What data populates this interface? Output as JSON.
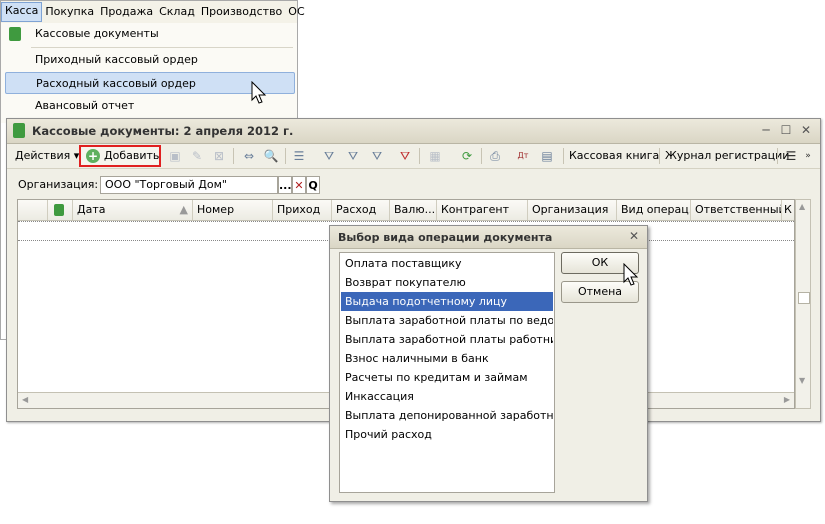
{
  "menubar": {
    "items": [
      "Касса",
      "Покупка",
      "Продажа",
      "Склад",
      "Производство",
      "ОС"
    ]
  },
  "dropdown": {
    "items": [
      "Кассовые документы",
      "Приходный кассовый ордер",
      "Расходный кассовый ордер",
      "Авансовый отчет"
    ]
  },
  "window": {
    "title": "Кассовые документы: 2 апреля 2012 г.",
    "controls": [
      "─",
      "☐",
      "✕"
    ]
  },
  "toolbar": {
    "actions_label": "Действия",
    "add_label": "Добавить",
    "cash_book_label": "Кассовая книга",
    "journal_label": "Журнал регистрации"
  },
  "filter": {
    "org_label": "Организация:",
    "org_value": "ООО \"Торговый Дом\"",
    "btn_select": "...",
    "btn_clear": "✕",
    "btn_open": "Q"
  },
  "grid": {
    "columns": [
      "Дата",
      "Номер",
      "Приход",
      "Расход",
      "Валю...",
      "Контрагент",
      "Организация",
      "Вид операц...",
      "Ответственный",
      "К"
    ]
  },
  "dialog": {
    "title": "Выбор вида операции документа",
    "close": "✕",
    "items": [
      "Оплата поставщику",
      "Возврат покупателю",
      "Выдача подотчетному лицу",
      "Выплата заработной платы по ведомо...",
      "Выплата заработной платы работнику",
      "Взнос наличными в банк",
      "Расчеты по кредитам и займам",
      "Инкассация",
      "Выплата депонированной заработной ...",
      "Прочий расход"
    ],
    "ok_label": "ОК",
    "cancel_label": "Отмена"
  },
  "colors": {
    "selection": "#3b67b9",
    "highlight_border": "#e02020",
    "menu_hover": "#cfe0f5"
  }
}
